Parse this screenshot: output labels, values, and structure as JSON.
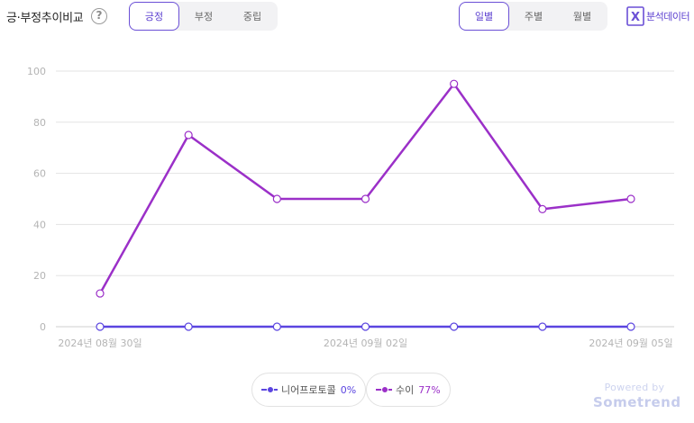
{
  "header": {
    "title": "긍·부정추이비교",
    "help_icon": "?",
    "sentiment_tabs": [
      {
        "label": "긍정",
        "active": true
      },
      {
        "label": "부정",
        "active": false
      },
      {
        "label": "중립",
        "active": false
      }
    ],
    "period_tabs": [
      {
        "label": "일별",
        "active": true
      },
      {
        "label": "주별",
        "active": false
      },
      {
        "label": "월별",
        "active": false
      }
    ],
    "excel_icon": "X",
    "excel_label": "분석데이터"
  },
  "colors": {
    "accent": "#5b3fd0",
    "series_1": "#5b45e0",
    "series_2": "#9b30c8",
    "grid": "#e3e3e3"
  },
  "chart_data": {
    "type": "line",
    "x": [
      "2024-08-30",
      "2024-08-31",
      "2024-09-01",
      "2024-09-02",
      "2024-09-03",
      "2024-09-04",
      "2024-09-05"
    ],
    "x_tick_labels": [
      {
        "index": 0,
        "label": "2024년 08월 30일"
      },
      {
        "index": 3,
        "label": "2024년 09월 02일"
      },
      {
        "index": 6,
        "label": "2024년 09월 05일"
      }
    ],
    "series": [
      {
        "name": "니어프로토콜",
        "values": [
          0,
          0,
          0,
          0,
          0,
          0,
          0
        ],
        "color": "#5b45e0"
      },
      {
        "name": "수이",
        "values": [
          13,
          75,
          50,
          50,
          95,
          46,
          50
        ],
        "color": "#9b30c8"
      }
    ],
    "ylim": [
      0,
      100
    ],
    "yticks": [
      0,
      20,
      40,
      60,
      80,
      100
    ],
    "grid": true,
    "legend_position": "bottom-center"
  },
  "legend": [
    {
      "name": "니어프로토콜",
      "pct": "0%",
      "color": "#5b45e0"
    },
    {
      "name": "수이",
      "pct": "77%",
      "color": "#9b30c8"
    }
  ],
  "branding": {
    "powered_by": "Powered by",
    "brand": "Sometrend"
  }
}
